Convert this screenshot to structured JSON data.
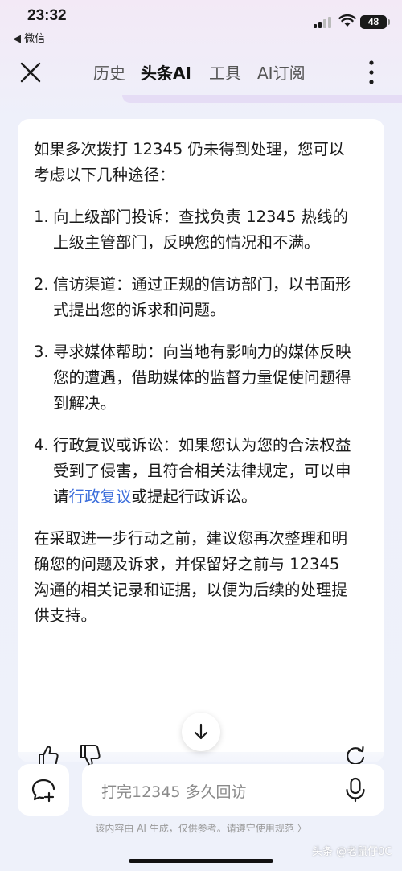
{
  "status_bar": {
    "time": "23:32",
    "back_app": "◀ 微信",
    "battery": "48"
  },
  "nav": {
    "tabs": [
      {
        "label": "历史",
        "active": false
      },
      {
        "label": "头条AI",
        "active": true
      },
      {
        "label": "工具",
        "active": false
      },
      {
        "label": "AI订阅",
        "active": false
      }
    ]
  },
  "answer": {
    "intro": "如果多次拨打 12345 仍未得到处理，您可以考虑以下几种途径：",
    "items": [
      {
        "num": "1.",
        "text": "向上级部门投诉：查找负责 12345 热线的上级主管部门，反映您的情况和不满。"
      },
      {
        "num": "2.",
        "text": "信访渠道：通过正规的信访部门，以书面形式提出您的诉求和问题。"
      },
      {
        "num": "3.",
        "text": "寻求媒体帮助：向当地有影响力的媒体反映您的遭遇，借助媒体的监督力量促使问题得到解决。"
      },
      {
        "num": "4.",
        "text_before": "行政复议或诉讼：如果您认为您的合法权益受到了侵害，且符合相关法律规定，可以申请",
        "link": "行政复议",
        "text_after": "或提起行政诉讼。"
      }
    ],
    "conclusion": "在采取进一步行动之前，建议您再次整理和明确您的问题及诉求，并保留好之前与 12345 沟通的相关记录和证据，以便为后续的处理提供支持。"
  },
  "input": {
    "placeholder": "打完12345 多久回访"
  },
  "disclaimer": "该内容由 AI 生成，仅供参考。请遵守使用规范 〉",
  "watermark": "头条 @老鼠仔0C",
  "colors": {
    "link": "#3b6ddb",
    "background": "#eef1fa"
  }
}
